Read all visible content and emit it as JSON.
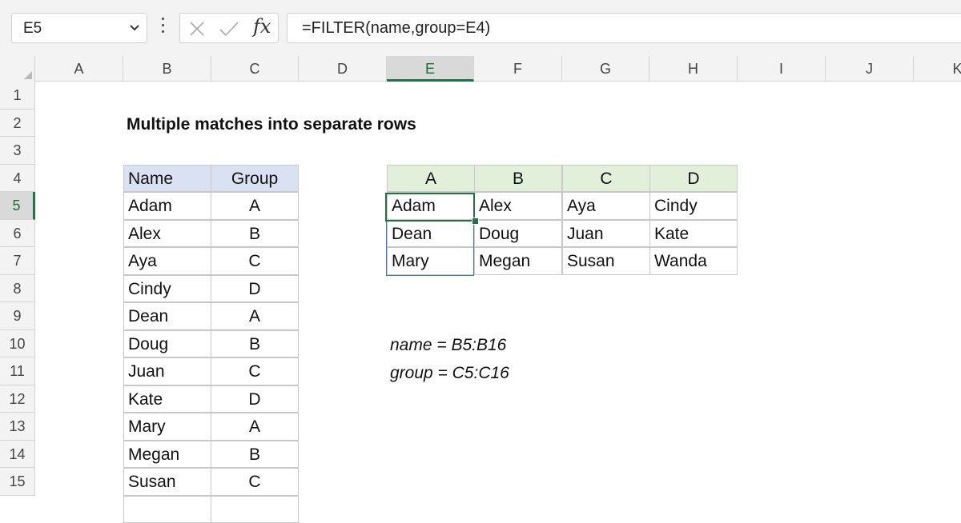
{
  "formula_bar": {
    "name_box": "E5",
    "formula": "=FILTER(name,group=E4)"
  },
  "icons": {
    "name_box_dropdown": "chevron-down-icon",
    "more": "vertical-dots-icon",
    "cancel": "x-icon",
    "enter": "check-icon",
    "insert_function": "fx-icon",
    "select_all": "select-all-triangle-icon"
  },
  "fx_label": "fx",
  "columns": [
    "A",
    "B",
    "C",
    "D",
    "E",
    "F",
    "G",
    "H",
    "I",
    "J",
    "K"
  ],
  "active_column": "E",
  "rows": [
    "1",
    "2",
    "3",
    "4",
    "5",
    "6",
    "7",
    "8",
    "9",
    "10",
    "11",
    "12",
    "13",
    "14",
    "15"
  ],
  "active_row": "5",
  "title": "Multiple matches into separate rows",
  "source_table": {
    "headers": [
      "Name",
      "Group"
    ],
    "rows": [
      [
        "Adam",
        "A"
      ],
      [
        "Alex",
        "B"
      ],
      [
        "Aya",
        "C"
      ],
      [
        "Cindy",
        "D"
      ],
      [
        "Dean",
        "A"
      ],
      [
        "Doug",
        "B"
      ],
      [
        "Juan",
        "C"
      ],
      [
        "Kate",
        "D"
      ],
      [
        "Mary",
        "A"
      ],
      [
        "Megan",
        "B"
      ],
      [
        "Susan",
        "C"
      ]
    ]
  },
  "result_table": {
    "headers": [
      "A",
      "B",
      "C",
      "D"
    ],
    "rows": [
      [
        "Adam",
        "Alex",
        "Aya",
        "Cindy"
      ],
      [
        "Dean",
        "Doug",
        "Juan",
        "Kate"
      ],
      [
        "Mary",
        "Megan",
        "Susan",
        "Wanda"
      ]
    ]
  },
  "named_ranges": [
    "name = B5:B16",
    "group = C5:C16"
  ],
  "colors": {
    "source_header": "#d9e1f2",
    "result_header": "#e2efda",
    "selection": "#217346",
    "spill_border": "#4472c4"
  }
}
